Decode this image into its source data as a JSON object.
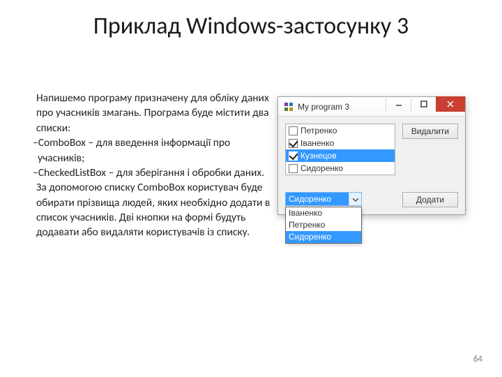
{
  "title": "Приклад Windows-застосунку 3",
  "pageNumber": "64",
  "text": {
    "p1": "Напишемо програму призначену для обліку даних про учасників змагань. Програма буде містити два списки:",
    "b1": "–ComboBox – для введення інформації про учасників;",
    "b2": "–CheckedListBox – для зберігання і обробки даних.",
    "p2": "За допомогою списку ComboBox користувач буде обирати прізвища людей, яких необхідно додати в список учасників. Дві кнопки на формі будуть додавати або видаляти користувачів із списку."
  },
  "window": {
    "title": "My program 3",
    "deleteBtn": "Видалити",
    "addBtn": "Додати",
    "checkedList": [
      {
        "label": "Петренко",
        "checked": false,
        "selected": false
      },
      {
        "label": "Іваненко",
        "checked": true,
        "selected": false
      },
      {
        "label": "Кузнецов",
        "checked": true,
        "selected": true
      },
      {
        "label": "Сидоренко",
        "checked": false,
        "selected": false
      }
    ],
    "combo": {
      "selected": "Сидоренко",
      "options": [
        {
          "label": "Іваненко",
          "highlight": false
        },
        {
          "label": "Петренко",
          "highlight": false
        },
        {
          "label": "Сидоренко",
          "highlight": true
        }
      ]
    }
  }
}
